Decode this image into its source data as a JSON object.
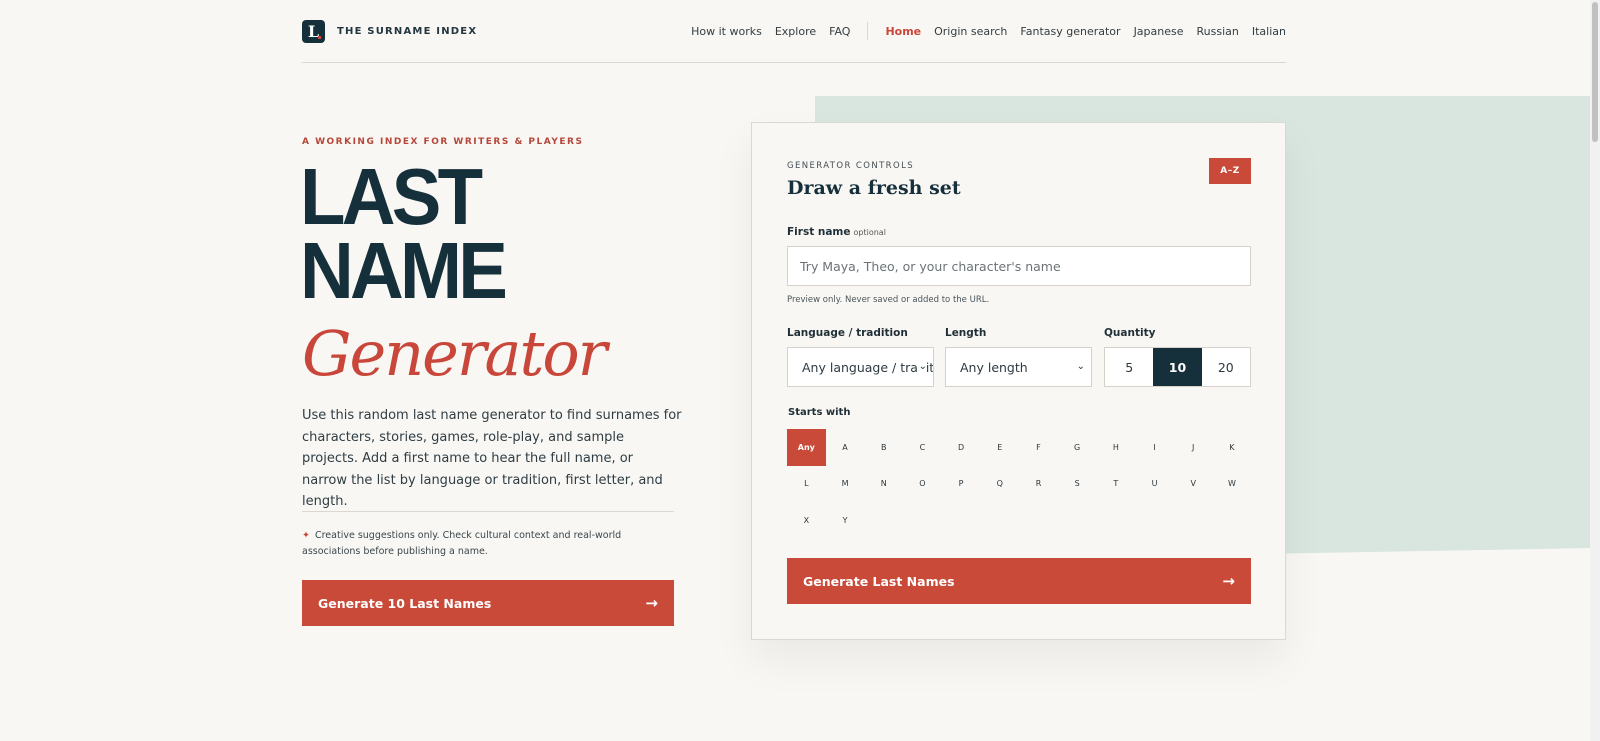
{
  "header": {
    "logo_letter": "L",
    "brand": "THE SURNAME INDEX",
    "nav_primary": [
      "How it works",
      "Explore",
      "FAQ"
    ],
    "nav_secondary": [
      "Home",
      "Origin search",
      "Fantasy generator",
      "Japanese",
      "Russian",
      "Italian"
    ]
  },
  "hero": {
    "eyebrow": "A WORKING INDEX FOR WRITERS & PLAYERS",
    "title_line1": "LAST",
    "title_line2": "NAME",
    "title_line3": "Generator",
    "description": "Use this random last name generator to find surnames for characters, stories, games, role-play, and sample projects. Add a first name to hear the full name, or narrow the list by language or tradition, first letter, and length.",
    "note_icon": "✦",
    "note": "Creative suggestions only. Check cultural context and real-world associations before publishing a name.",
    "cta_label": "Generate 10 Last Names",
    "cta_arrow": "→"
  },
  "card": {
    "eyebrow": "GENERATOR CONTROLS",
    "title": "Draw a fresh set",
    "az_label": "A–Z",
    "first_name_label": "First name",
    "first_name_optional": "optional",
    "first_name_placeholder": "Try Maya, Theo, or your character's name",
    "first_name_value": "",
    "helper": "Preview only. Never saved or added to the URL.",
    "language_label": "Language / tradition",
    "language_value": "Any language / tradition",
    "length_label": "Length",
    "length_value": "Any length",
    "quantity_label": "Quantity",
    "quantity_options": [
      "5",
      "10",
      "20"
    ],
    "starts_with_label": "Starts with",
    "letters": [
      "Any",
      "A",
      "B",
      "C",
      "D",
      "E",
      "F",
      "G",
      "H",
      "I",
      "J",
      "K",
      "L",
      "M",
      "N",
      "O",
      "P",
      "Q",
      "R",
      "S",
      "T",
      "U",
      "V",
      "W",
      "X",
      "Y"
    ],
    "cta_label": "Generate Last Names",
    "cta_arrow": "→",
    "chevron": "⌄"
  },
  "colors": {
    "accent": "#c94a39",
    "navy": "#16303b",
    "background": "#f9f7f3",
    "mint": "#d9e5df"
  }
}
